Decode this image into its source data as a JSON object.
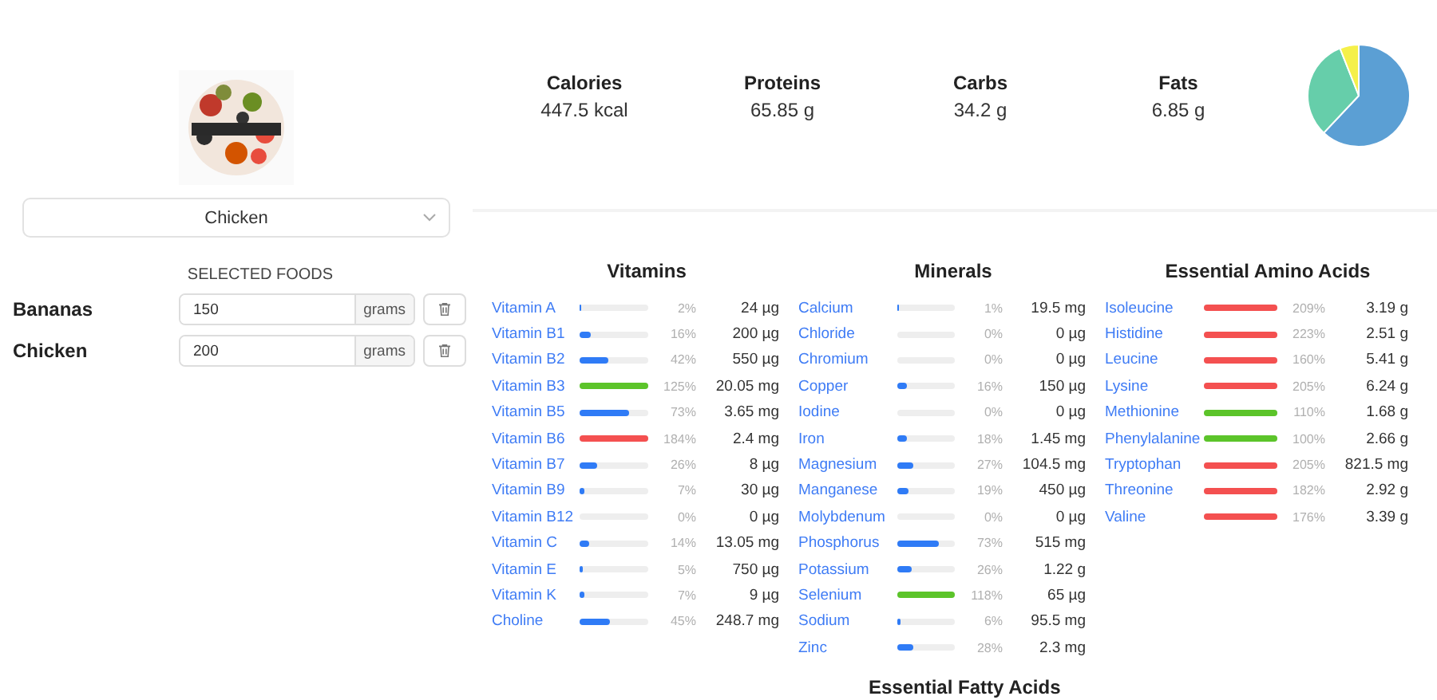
{
  "food_select": {
    "value": "Chicken"
  },
  "selected_foods": {
    "title": "SELECTED FOODS",
    "items": [
      {
        "name": "Bananas",
        "amount": "150",
        "unit": "grams"
      },
      {
        "name": "Chicken",
        "amount": "200",
        "unit": "grams"
      }
    ]
  },
  "summary": [
    {
      "label": "Calories",
      "value": "447.5 kcal"
    },
    {
      "label": "Proteins",
      "value": "65.85 g"
    },
    {
      "label": "Carbs",
      "value": "34.2 g"
    },
    {
      "label": "Fats",
      "value": "6.85 g"
    }
  ],
  "sections": [
    {
      "title": "Vitamins",
      "items": [
        {
          "name": "Vitamin A",
          "level": 0.02,
          "color": "#2f7bf6",
          "percent": "2%",
          "amount": "24 µg"
        },
        {
          "name": "Vitamin B1",
          "level": 0.16,
          "color": "#2f7bf6",
          "percent": "16%",
          "amount": "200 µg"
        },
        {
          "name": "Vitamin B2",
          "level": 0.42,
          "color": "#2f7bf6",
          "percent": "42%",
          "amount": "550 µg"
        },
        {
          "name": "Vitamin B3",
          "level": 1,
          "color": "#5cc42a",
          "percent": "125%",
          "amount": "20.05 mg"
        },
        {
          "name": "Vitamin B5",
          "level": 0.73,
          "color": "#2f7bf6",
          "percent": "73%",
          "amount": "3.65 mg"
        },
        {
          "name": "Vitamin B6",
          "level": 1,
          "color": "#f45050",
          "percent": "184%",
          "amount": "2.4 mg"
        },
        {
          "name": "Vitamin B7",
          "level": 0.26,
          "color": "#2f7bf6",
          "percent": "26%",
          "amount": "8 µg"
        },
        {
          "name": "Vitamin B9",
          "level": 0.07,
          "color": "#2f7bf6",
          "percent": "7%",
          "amount": "30 µg"
        },
        {
          "name": "Vitamin B12",
          "percent": "0%",
          "amount": "0 µg"
        },
        {
          "name": "Vitamin C",
          "level": 0.14,
          "color": "#2f7bf6",
          "percent": "14%",
          "amount": "13.05 mg"
        },
        {
          "name": "Vitamin E",
          "level": 0.05,
          "color": "#2f7bf6",
          "percent": "5%",
          "amount": "750 µg"
        },
        {
          "name": "Vitamin K",
          "level": 0.07,
          "color": "#2f7bf6",
          "percent": "7%",
          "amount": "9 µg"
        },
        {
          "name": "Choline",
          "level": 0.45,
          "color": "#2f7bf6",
          "percent": "45%",
          "amount": "248.7 mg"
        }
      ]
    },
    {
      "title": "Minerals",
      "items": [
        {
          "name": "Calcium",
          "level": 0.01,
          "color": "#2f7bf6",
          "percent": "1%",
          "amount": "19.5 mg"
        },
        {
          "name": "Chloride",
          "percent": "0%",
          "amount": "0 µg"
        },
        {
          "name": "Chromium",
          "percent": "0%",
          "amount": "0 µg"
        },
        {
          "name": "Copper",
          "level": 0.16,
          "color": "#2f7bf6",
          "percent": "16%",
          "amount": "150 µg"
        },
        {
          "name": "Iodine",
          "percent": "0%",
          "amount": "0 µg"
        },
        {
          "name": "Iron",
          "level": 0.18,
          "color": "#2f7bf6",
          "percent": "18%",
          "amount": "1.45 mg"
        },
        {
          "name": "Magnesium",
          "level": 0.27,
          "color": "#2f7bf6",
          "percent": "27%",
          "amount": "104.5 mg"
        },
        {
          "name": "Manganese",
          "level": 0.19,
          "color": "#2f7bf6",
          "percent": "19%",
          "amount": "450 µg"
        },
        {
          "name": "Molybdenum",
          "percent": "0%",
          "amount": "0 µg"
        },
        {
          "name": "Phosphorus",
          "level": 0.73,
          "color": "#2f7bf6",
          "percent": "73%",
          "amount": "515 mg"
        },
        {
          "name": "Potassium",
          "level": 0.26,
          "color": "#2f7bf6",
          "percent": "26%",
          "amount": "1.22 g"
        },
        {
          "name": "Selenium",
          "level": 1,
          "color": "#5cc42a",
          "percent": "118%",
          "amount": "65 µg"
        },
        {
          "name": "Sodium",
          "level": 0.06,
          "color": "#2f7bf6",
          "percent": "6%",
          "amount": "95.5 mg"
        },
        {
          "name": "Zinc",
          "level": 0.28,
          "color": "#2f7bf6",
          "percent": "28%",
          "amount": "2.3 mg"
        }
      ]
    },
    {
      "title": "Essential Amino Acids",
      "items": [
        {
          "name": "Isoleucine",
          "level": 1,
          "color": "#f45050",
          "percent": "209%",
          "amount": "3.19 g"
        },
        {
          "name": "Histidine",
          "level": 1,
          "color": "#f45050",
          "percent": "223%",
          "amount": "2.51 g"
        },
        {
          "name": "Leucine",
          "level": 1,
          "color": "#f45050",
          "percent": "160%",
          "amount": "5.41 g"
        },
        {
          "name": "Lysine",
          "level": 1,
          "color": "#f45050",
          "percent": "205%",
          "amount": "6.24 g"
        },
        {
          "name": "Methionine",
          "level": 1,
          "color": "#5cc42a",
          "percent": "110%",
          "amount": "1.68 g"
        },
        {
          "name": "Phenylalanine",
          "level": 1,
          "color": "#5cc42a",
          "percent": "100%",
          "amount": "2.66 g"
        },
        {
          "name": "Tryptophan",
          "level": 1,
          "color": "#f45050",
          "percent": "205%",
          "amount": "821.5 mg"
        },
        {
          "name": "Threonine",
          "level": 1,
          "color": "#f45050",
          "percent": "182%",
          "amount": "2.92 g"
        },
        {
          "name": "Valine",
          "level": 1,
          "color": "#f45050",
          "percent": "176%",
          "amount": "3.39 g"
        }
      ]
    }
  ],
  "next_section": {
    "title": "Essential Fatty Acids"
  }
}
